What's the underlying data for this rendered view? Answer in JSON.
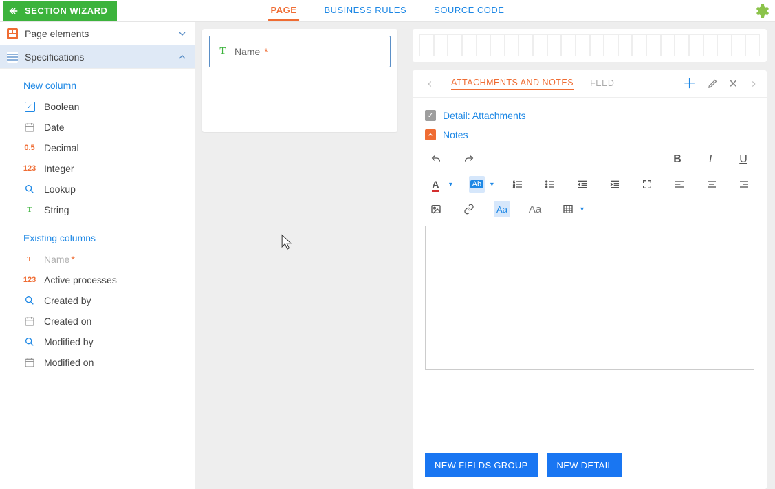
{
  "header": {
    "wizard_label": "SECTION WIZARD",
    "tabs": {
      "page": "PAGE",
      "business_rules": "BUSINESS RULES",
      "source_code": "SOURCE CODE"
    }
  },
  "sidebar": {
    "groups": {
      "page_elements": "Page elements",
      "specifications": "Specifications"
    },
    "new_column_title": "New column",
    "new_columns": {
      "boolean": "Boolean",
      "date": "Date",
      "decimal": "Decimal",
      "integer": "Integer",
      "lookup": "Lookup",
      "string": "String"
    },
    "existing_columns_title": "Existing columns",
    "existing": {
      "name": "Name",
      "active_processes": "Active processes",
      "created_by": "Created by",
      "created_on": "Created on",
      "modified_by": "Modified by",
      "modified_on": "Modified on"
    }
  },
  "canvas": {
    "name_field_label": "Name"
  },
  "detail": {
    "tabs": {
      "attachments": "ATTACHMENTS AND NOTES",
      "feed": "FEED"
    },
    "lines": {
      "attachments": "Detail: Attachments",
      "notes": "Notes"
    }
  },
  "buttons": {
    "new_fields_group": "NEW FIELDS GROUP",
    "new_detail": "NEW DETAIL"
  }
}
